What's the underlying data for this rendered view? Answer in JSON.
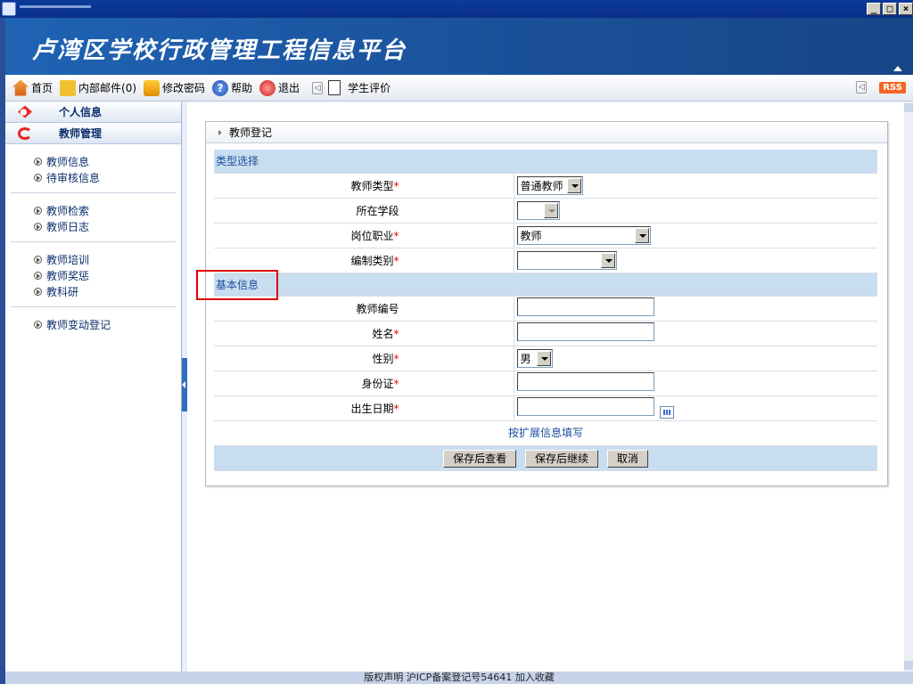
{
  "window": {
    "buttons": [
      "_",
      "□",
      "×"
    ]
  },
  "header": {
    "title": "卢湾区学校行政管理工程信息平台"
  },
  "toolbar": {
    "items": [
      {
        "label": "首页",
        "icon": "home-icon"
      },
      {
        "label": "内部邮件(0)",
        "icon": "mail-icon"
      },
      {
        "label": "修改密码",
        "icon": "key-icon"
      },
      {
        "label": "帮助",
        "icon": "help-icon"
      },
      {
        "label": "退出",
        "icon": "exit-icon"
      }
    ],
    "student_eval": "学生评价",
    "rss": "RSS"
  },
  "sidebar": {
    "heads": [
      {
        "label": "个人信息",
        "icon": "personal-icon"
      },
      {
        "label": "教师管理",
        "icon": "teacher-icon"
      }
    ],
    "groups": [
      [
        "教师信息",
        "待审核信息"
      ],
      [
        "教师检索",
        "教师日志"
      ],
      [
        "教师培训",
        "教师奖惩",
        "教科研"
      ],
      [
        "教师变动登记"
      ]
    ]
  },
  "panel": {
    "title": "教师登记",
    "sections": {
      "type": "类型选择",
      "basic": "基本信息"
    },
    "fields": {
      "teacher_type": {
        "label": "教师类型",
        "value": "普通教师"
      },
      "stage": {
        "label": "所在学段",
        "value": ""
      },
      "post": {
        "label": "岗位职业",
        "value": "教师"
      },
      "staffing": {
        "label": "编制类别",
        "value": ""
      },
      "teacher_no": {
        "label": "教师编号"
      },
      "name": {
        "label": "姓名"
      },
      "gender": {
        "label": "性别",
        "value": "男"
      },
      "id_card": {
        "label": "身份证"
      },
      "birth": {
        "label": "出生日期"
      }
    },
    "required_mark": "*",
    "ext_link": "按扩展信息填写",
    "buttons": {
      "save_view": "保存后查看",
      "save_continue": "保存后继续",
      "cancel": "取消"
    }
  },
  "footer": {
    "text": "版权声明 沪ICP备案登记号54641   加入收藏"
  },
  "colors": {
    "banner": "#1f63b4",
    "section_bg": "#c9ddf0",
    "highlight": "#e00000",
    "required": "#e00000"
  }
}
